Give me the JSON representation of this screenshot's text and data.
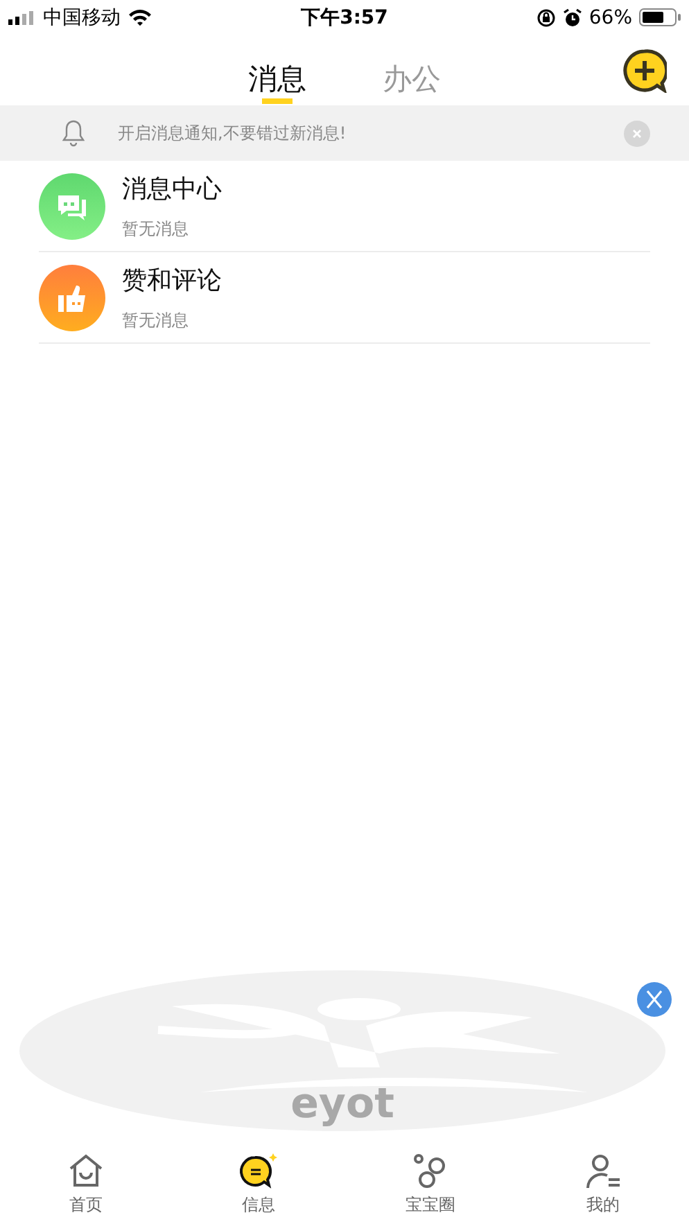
{
  "status_bar": {
    "carrier": "中国移动",
    "time": "下午3:57",
    "battery": "66%"
  },
  "tabs": [
    {
      "label": "消息",
      "selected": true
    },
    {
      "label": "办公",
      "selected": false
    }
  ],
  "notice": {
    "text": "开启消息通知,不要错过新消息!"
  },
  "conversations": [
    {
      "kind": "system",
      "title": "消息中心",
      "subtitle": "暂无消息"
    },
    {
      "kind": "likes",
      "title": "赞和评论",
      "subtitle": "暂无消息"
    }
  ],
  "floating_logo": {
    "text": "eyot"
  },
  "bottom_nav": [
    {
      "kind": "home",
      "label": "首页",
      "selected": false
    },
    {
      "kind": "messages",
      "label": "信息",
      "selected": true
    },
    {
      "kind": "circle",
      "label": "宝宝圈",
      "selected": false
    },
    {
      "kind": "profile",
      "label": "我的",
      "selected": false
    }
  ]
}
